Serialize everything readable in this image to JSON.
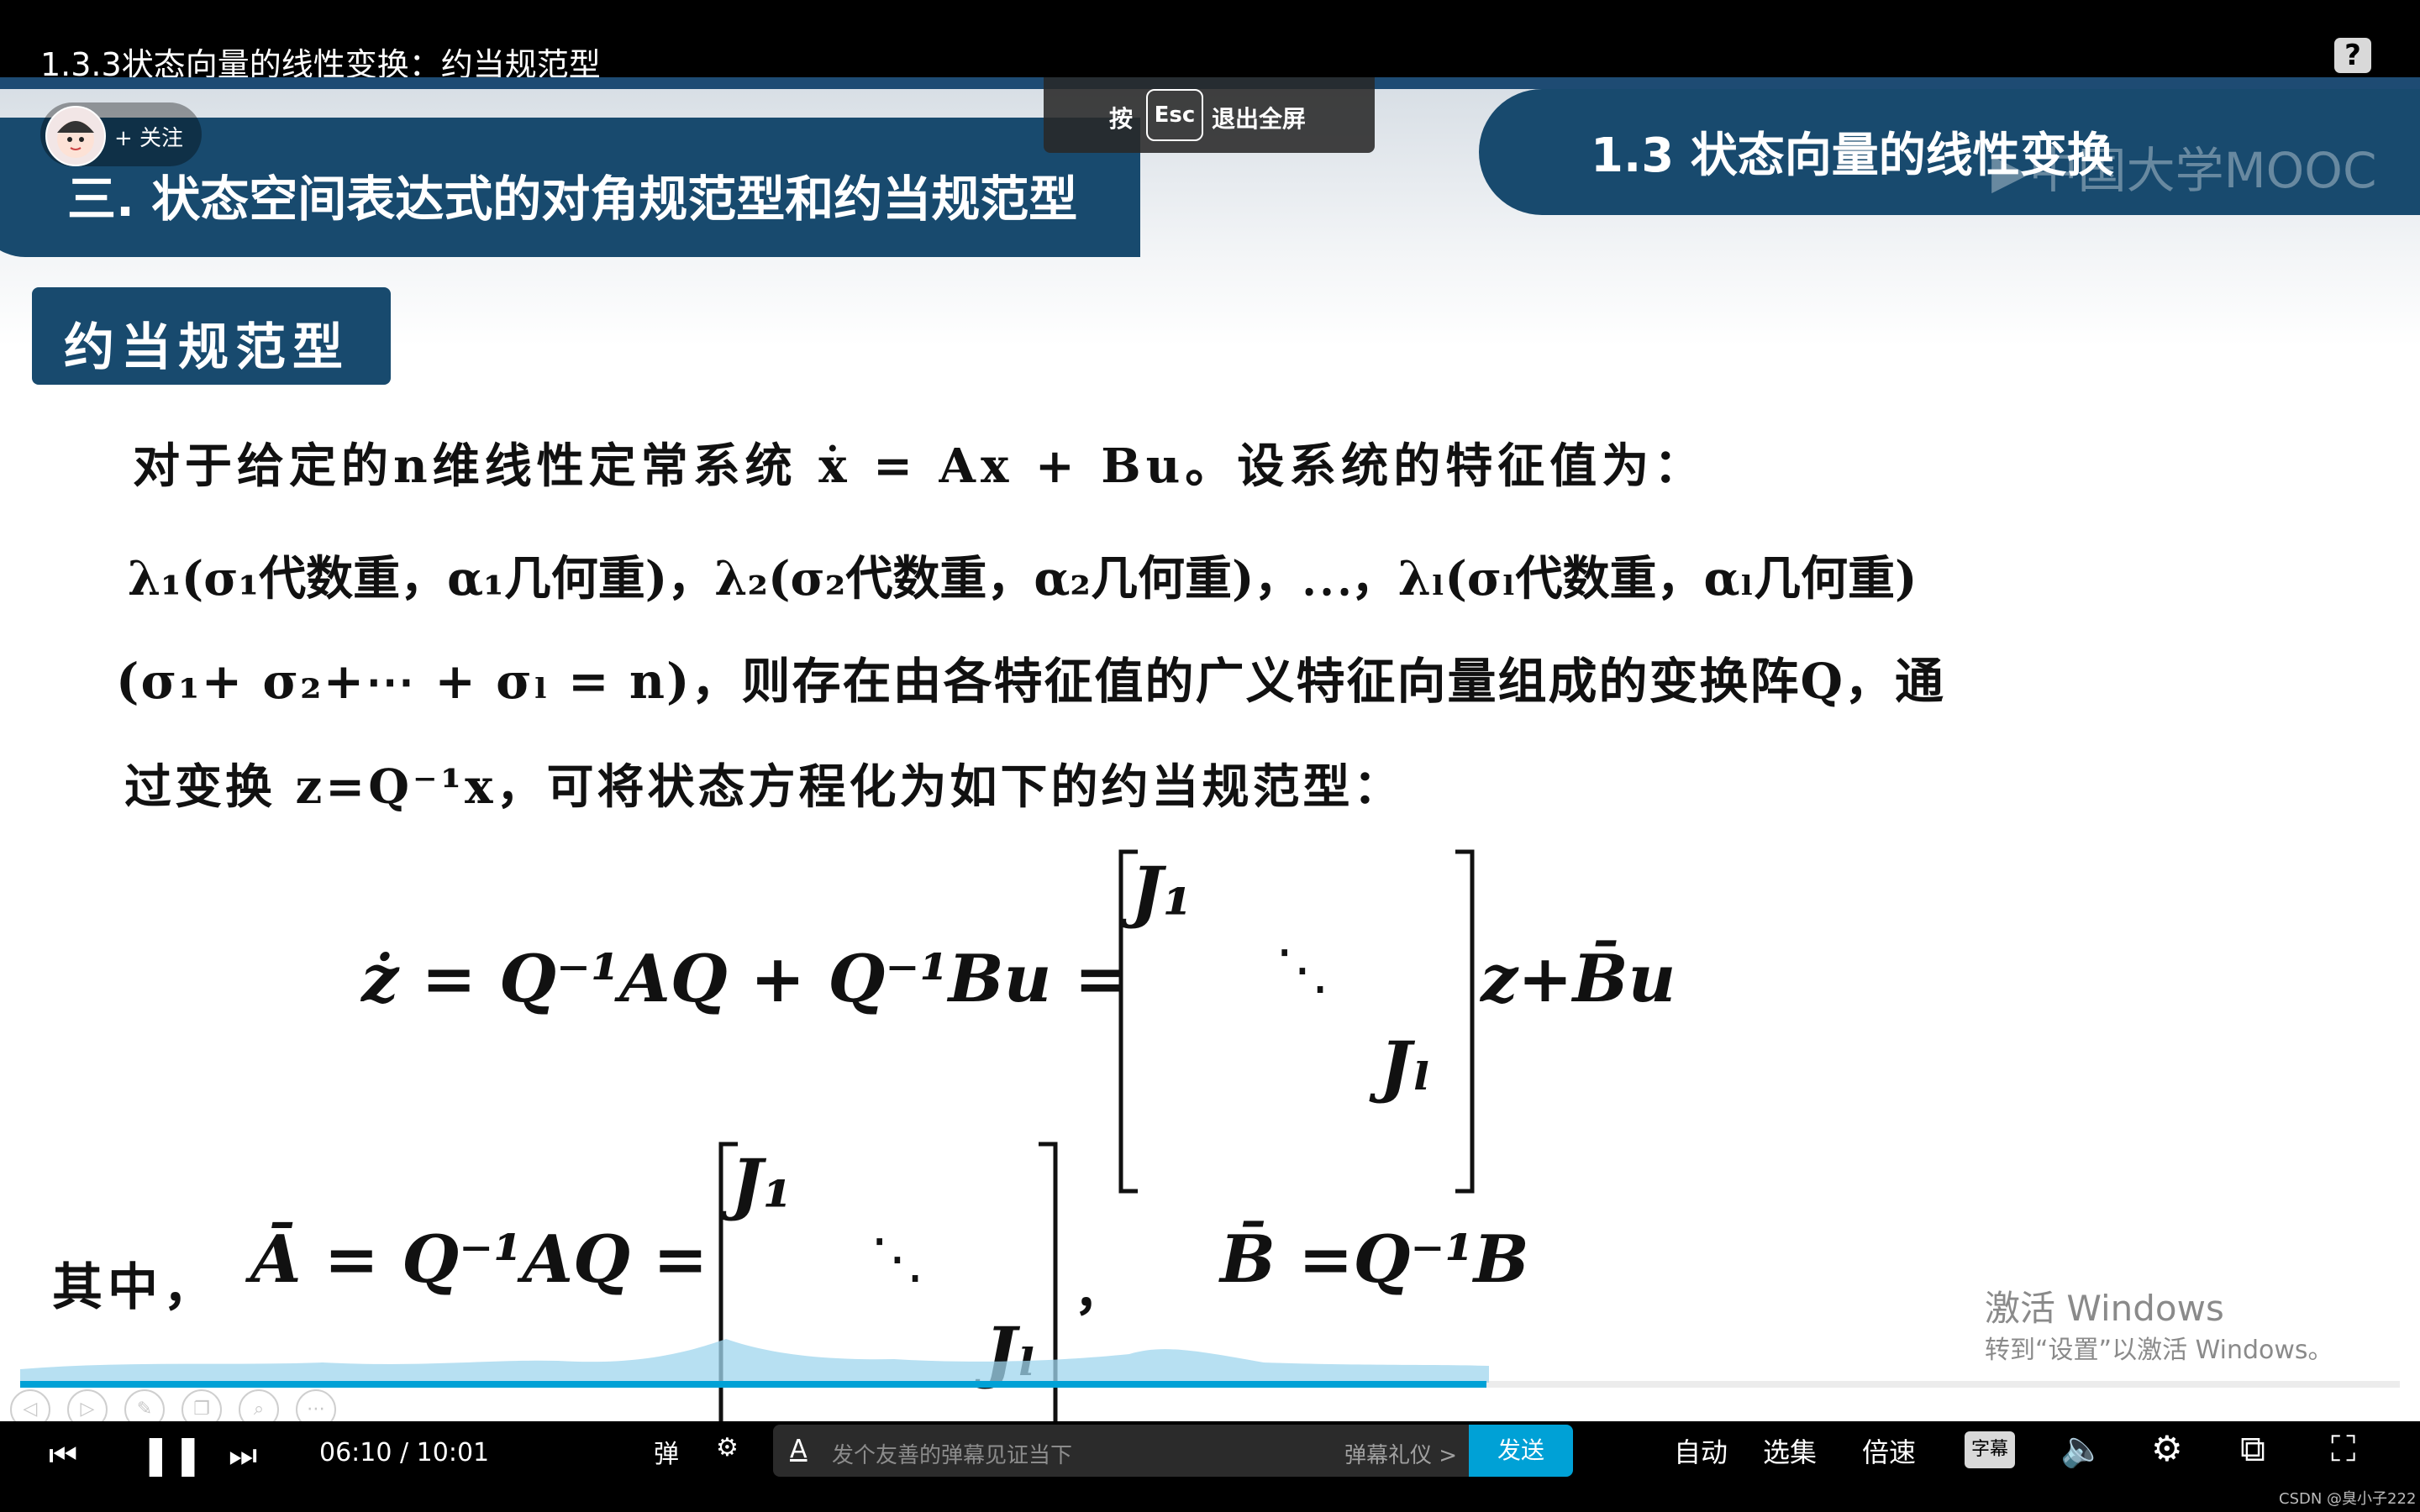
{
  "window": {
    "title": "1.3.3状态向量的线性变换：约当规范型"
  },
  "slide": {
    "left_banner": "三. 状态空间表达式的对角规范型和约当规范型",
    "right_banner": "1.3 状态向量的线性变换",
    "watermark": "中国大学MOOC",
    "section_label": "约当规范型",
    "line1": "对于给定的n维线性定常系统 ẋ = Ax + Bu。设系统的特征值为：",
    "line2": "λ₁(σ₁代数重，α₁几何重)，λ₂(σ₂代数重，α₂几何重)，⋯，λₗ(σₗ代数重，αₗ几何重)",
    "line3": "(σ₁+ σ₂+⋯ + σₗ = n)，则存在由各特征值的广义特征向量组成的变换阵Q，通",
    "line4": "过变换 z=Q⁻¹x，可将状态方程化为如下的约当规范型：",
    "eq1_lhs": "ż = Q⁻¹AQ + Q⁻¹Bu =",
    "eq1_rhs": "z+B̄u",
    "eq2_prefix": "其中，",
    "eq2_lhs": "Ā = Q⁻¹AQ =",
    "eq2_comma": "，",
    "eq2_rhs": "B̄ =Q⁻¹B",
    "matrix_top": "J₁",
    "matrix_dots": "⋱",
    "matrix_bottom": "Jₗ",
    "activation_title": "激活 Windows",
    "activation_sub": "转到“设置”以激活 Windows。"
  },
  "uploader": {
    "follow_label": "+ 关注"
  },
  "esc_toast": {
    "press": "按",
    "key": "Esc",
    "exit": "退出全屏"
  },
  "player": {
    "current_time": "06:10",
    "separator": "/",
    "duration": "10:01",
    "progress": 0.616,
    "danmaku_placeholder": "发个友善的弹幕见证当下",
    "danmaku_etiquette": "弹幕礼仪 >",
    "send_label": "发送",
    "auto_label": "自动",
    "episodes_label": "选集",
    "speed_label": "倍速",
    "subtitle_label": "字幕"
  },
  "credit": "CSDN @臭小子222",
  "colors": {
    "banner": "#184a6e",
    "accent": "#00a1d6"
  }
}
